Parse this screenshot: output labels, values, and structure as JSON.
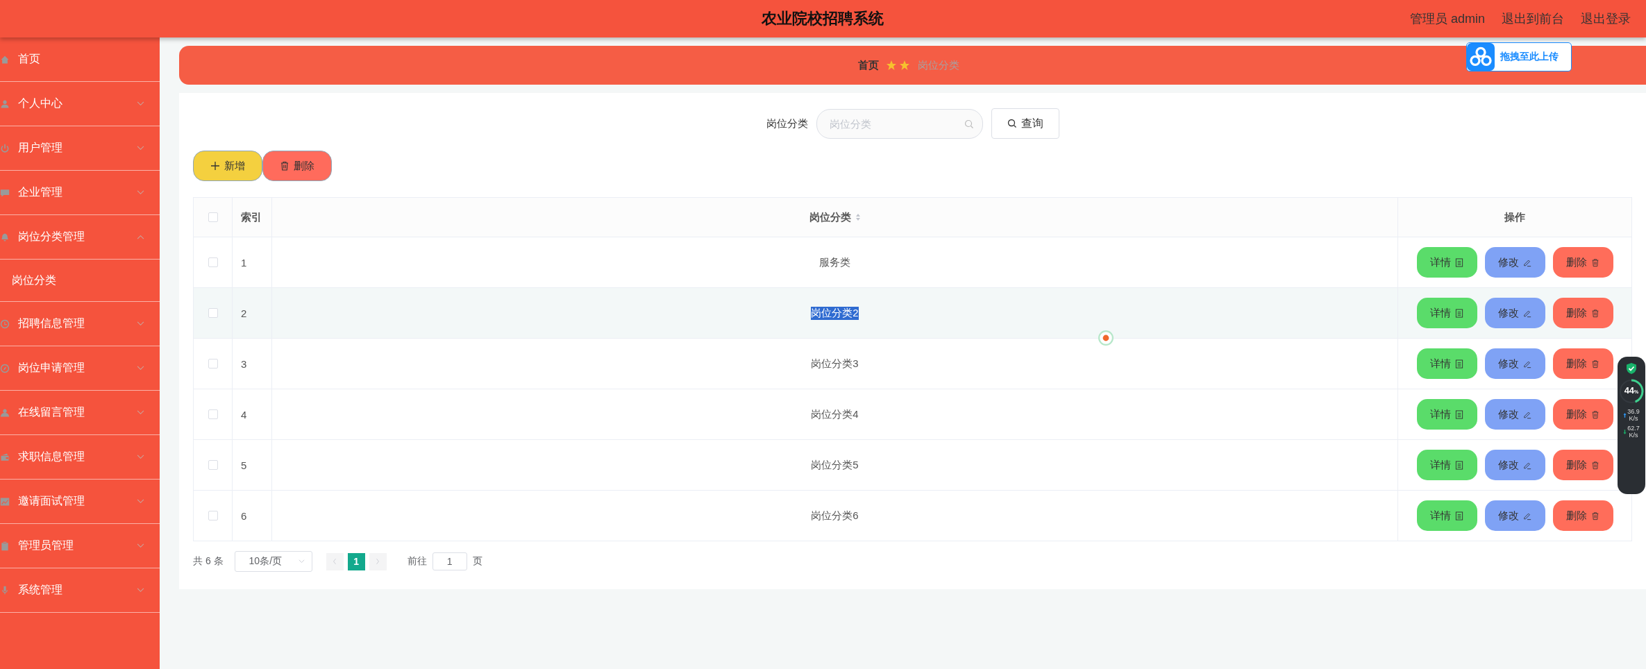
{
  "header": {
    "title": "农业院校招聘系统",
    "links": [
      {
        "label": "管理员 admin"
      },
      {
        "label": "退出到前台"
      },
      {
        "label": "退出登录"
      }
    ]
  },
  "sidebar": {
    "items": [
      {
        "label": "首页"
      },
      {
        "label": "个人中心",
        "expanded": false
      },
      {
        "label": "用户管理",
        "expanded": false
      },
      {
        "label": "企业管理",
        "expanded": false
      },
      {
        "label": "岗位分类管理",
        "expanded": true,
        "children": [
          {
            "label": "岗位分类"
          }
        ]
      },
      {
        "label": "招聘信息管理",
        "expanded": false
      },
      {
        "label": "岗位申请管理",
        "expanded": false
      },
      {
        "label": "在线留言管理",
        "expanded": false
      },
      {
        "label": "求职信息管理",
        "expanded": false
      },
      {
        "label": "邀请面试管理",
        "expanded": false
      },
      {
        "label": "管理员管理",
        "expanded": false
      },
      {
        "label": "系统管理",
        "expanded": false
      }
    ]
  },
  "breadcrumb": [
    {
      "label": "首页",
      "current": false
    },
    {
      "label": "岗位分类",
      "current": true
    }
  ],
  "upload_widget": {
    "label": "拖拽至此上传"
  },
  "search": {
    "label": "岗位分类",
    "placeholder": "岗位分类",
    "button": "查询"
  },
  "toolbar": [
    {
      "kind": "add",
      "label": "新增"
    },
    {
      "kind": "delete",
      "label": "删除"
    }
  ],
  "table": {
    "header_checked": false,
    "columns": [
      {
        "label": "索引"
      },
      {
        "label": "岗位分类",
        "sortable": true
      },
      {
        "label": "操作"
      }
    ],
    "rows": [
      {
        "index": "1",
        "category": "服务类",
        "checked": false,
        "hovered": false,
        "highlighted": false,
        "actions": [
          {
            "kind": "detail",
            "label": "详情"
          },
          {
            "kind": "edit",
            "label": "修改"
          },
          {
            "kind": "delete",
            "label": "删除"
          }
        ]
      },
      {
        "index": "2",
        "category": "岗位分类2",
        "checked": false,
        "hovered": true,
        "highlighted": true,
        "actions": [
          {
            "kind": "detail",
            "label": "详情"
          },
          {
            "kind": "edit",
            "label": "修改"
          },
          {
            "kind": "delete",
            "label": "删除"
          }
        ]
      },
      {
        "index": "3",
        "category": "岗位分类3",
        "checked": false,
        "hovered": false,
        "highlighted": false,
        "actions": [
          {
            "kind": "detail",
            "label": "详情"
          },
          {
            "kind": "edit",
            "label": "修改"
          },
          {
            "kind": "delete",
            "label": "删除"
          }
        ]
      },
      {
        "index": "4",
        "category": "岗位分类4",
        "checked": false,
        "hovered": false,
        "highlighted": false,
        "actions": [
          {
            "kind": "detail",
            "label": "详情"
          },
          {
            "kind": "edit",
            "label": "修改"
          },
          {
            "kind": "delete",
            "label": "删除"
          }
        ]
      },
      {
        "index": "5",
        "category": "岗位分类5",
        "checked": false,
        "hovered": false,
        "highlighted": false,
        "actions": [
          {
            "kind": "detail",
            "label": "详情"
          },
          {
            "kind": "edit",
            "label": "修改"
          },
          {
            "kind": "delete",
            "label": "删除"
          }
        ]
      },
      {
        "index": "6",
        "category": "岗位分类6",
        "checked": false,
        "hovered": false,
        "highlighted": false,
        "actions": [
          {
            "kind": "detail",
            "label": "详情"
          },
          {
            "kind": "edit",
            "label": "修改"
          },
          {
            "kind": "delete",
            "label": "删除"
          }
        ]
      }
    ]
  },
  "pagination": {
    "total": "共 6 条",
    "page_size": "10条/页",
    "pages": [
      {
        "label": "1",
        "selected": true
      }
    ],
    "goto_label": "前往",
    "goto_value": "1",
    "goto_suffix": "页"
  },
  "net_monitor": {
    "level": 0.44,
    "percent": "44",
    "percent_unit": "%",
    "upload": "36.9",
    "upload_unit": "K/s",
    "download": "62.7",
    "download_unit": "K/s"
  }
}
